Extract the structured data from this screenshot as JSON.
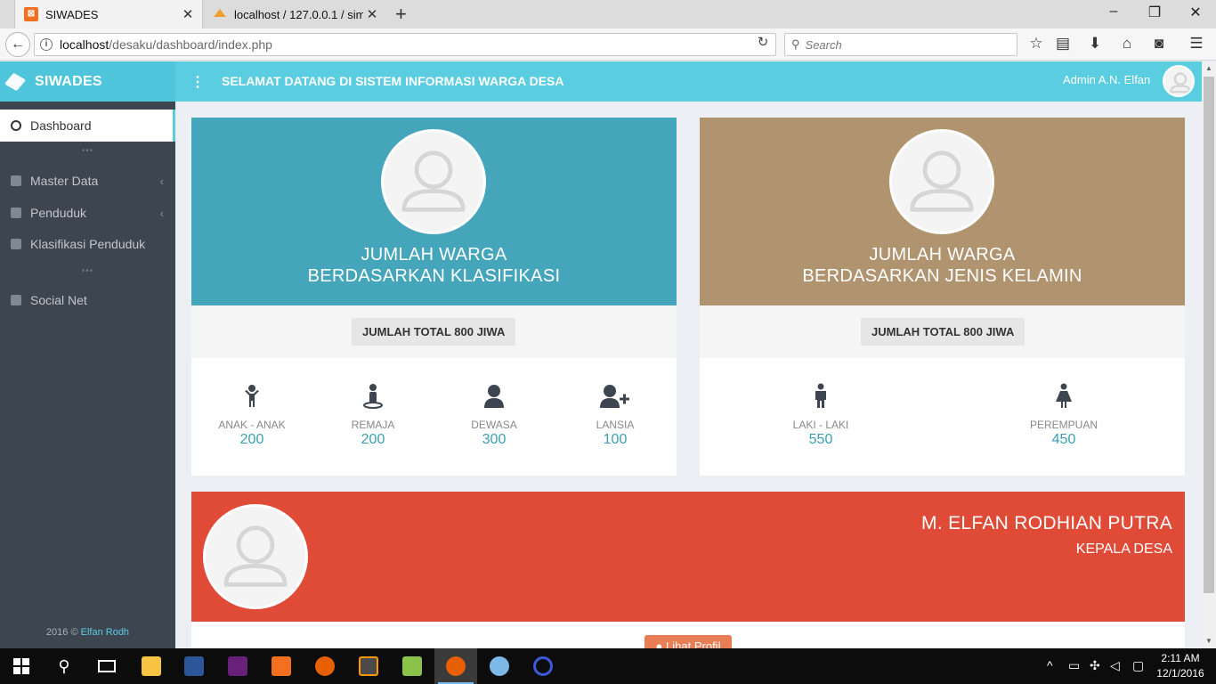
{
  "browser": {
    "tabs": [
      {
        "title": "SIWADES",
        "icon": "xampp-icon",
        "active": true
      },
      {
        "title": "localhost / 127.0.0.1 / sim…",
        "icon": "phpmyadmin-icon",
        "active": false
      }
    ],
    "url_host": "localhost",
    "url_path": "/desaku/dashboard/index.php",
    "search_placeholder": "Search",
    "window_controls": [
      "minimize",
      "restore",
      "close"
    ]
  },
  "header": {
    "brand": "SIWADES",
    "welcome": "SELAMAT DATANG DI SISTEM INFORMASI WARGA DESA",
    "user_name": "Admin A.N. Elfan"
  },
  "sidebar": {
    "items": [
      {
        "label": "Dashboard",
        "icon": "dashboard-icon",
        "active": true,
        "has_submenu": false
      },
      {
        "label": "Master Data",
        "icon": "home-icon",
        "active": false,
        "has_submenu": true
      },
      {
        "label": "Penduduk",
        "icon": "users-icon",
        "active": false,
        "has_submenu": true
      },
      {
        "label": "Klasifikasi Penduduk",
        "icon": "child-icon",
        "active": false,
        "has_submenu": false
      },
      {
        "label": "Social Net",
        "icon": "share-icon",
        "active": false,
        "has_submenu": false
      }
    ],
    "separator": "•••",
    "footer_prefix": "2016 ©",
    "footer_link": "Elfan Rodh"
  },
  "panels": {
    "klasifikasi": {
      "title_line1": "JUMLAH WARGA",
      "title_line2": "BERDASARKAN KLASIFIKASI",
      "total": "JUMLAH TOTAL 800 JIWA",
      "color": "#45a6bb",
      "stats": [
        {
          "label": "ANAK - ANAK",
          "value": "200",
          "icon": "child-icon"
        },
        {
          "label": "REMAJA",
          "value": "200",
          "icon": "teen-icon"
        },
        {
          "label": "DEWASA",
          "value": "300",
          "icon": "adult-icon"
        },
        {
          "label": "LANSIA",
          "value": "100",
          "icon": "user-plus-icon"
        }
      ]
    },
    "jenis_kelamin": {
      "title_line1": "JUMLAH WARGA",
      "title_line2": "BERDASARKAN JENIS KELAMIN",
      "total": "JUMLAH TOTAL 800 JIWA",
      "color": "#b09470",
      "stats": [
        {
          "label": "LAKI - LAKI",
          "value": "550",
          "icon": "male-icon"
        },
        {
          "label": "PEREMPUAN",
          "value": "450",
          "icon": "female-icon"
        }
      ]
    }
  },
  "profile": {
    "name": "M. ELFAN RODHIAN PUTRA",
    "role": "KEPALA DESA",
    "button_label": "Lihat Profil",
    "color": "#e04b37"
  },
  "taskbar": {
    "apps": [
      "start-icon",
      "search-icon",
      "task-view-icon",
      "file-explorer-icon",
      "word-icon",
      "visual-studio-icon",
      "xampp-icon",
      "firefox-icon",
      "sublime-text-icon",
      "notepad-icon",
      "firefox-active-icon",
      "paint-icon",
      "app-icon"
    ],
    "time": "2:11 AM",
    "date": "12/1/2016"
  }
}
